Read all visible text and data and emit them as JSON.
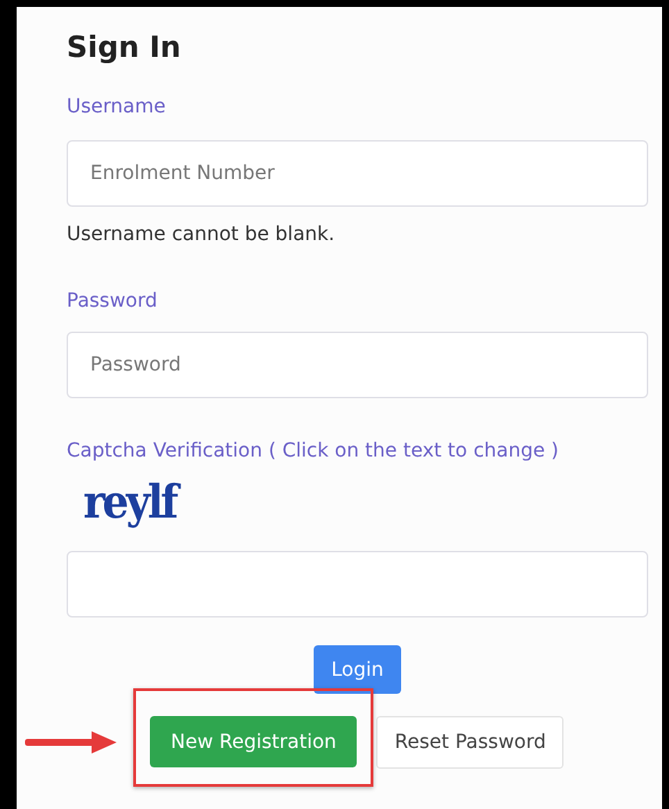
{
  "title": "Sign In",
  "fields": [
    {
      "label": "Username",
      "placeholder": "Enrolment Number",
      "error": "Username cannot be blank."
    },
    {
      "label": "Password",
      "placeholder": "Password"
    }
  ],
  "captcha": {
    "label": "Captcha Verification ( Click on the text to change )",
    "text": "reylf"
  },
  "buttons": [
    {
      "label": "Login",
      "kind": "primary"
    },
    {
      "label": "New Registration",
      "kind": "success",
      "highlighted": true
    },
    {
      "label": "Reset Password",
      "kind": "outline"
    }
  ]
}
